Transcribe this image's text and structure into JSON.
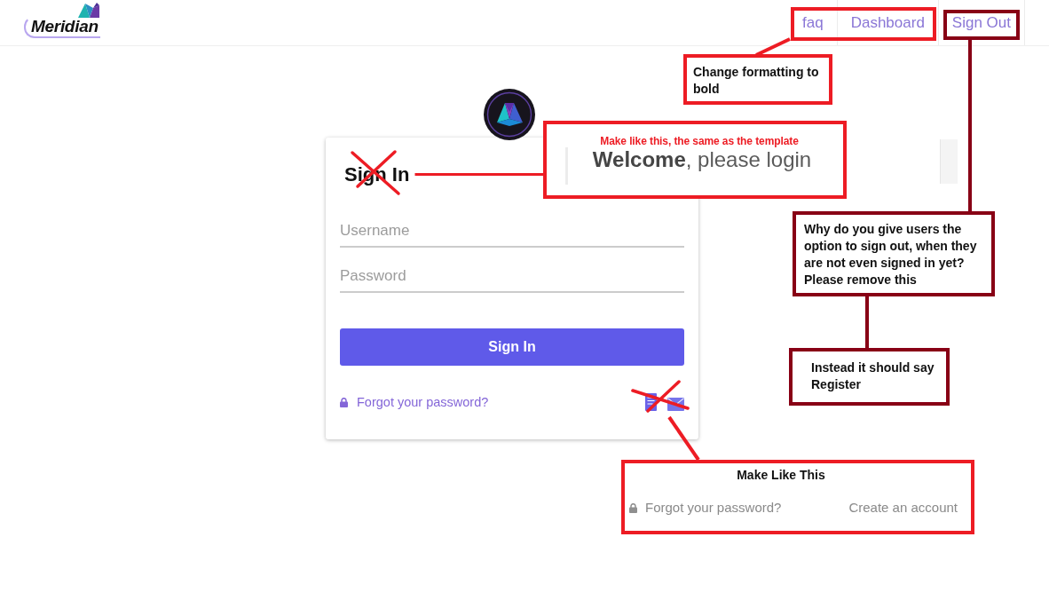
{
  "header": {
    "logo": "Meridian",
    "nav_groups": [
      {
        "color": "#ed1c24",
        "links": [
          {
            "label": "faq"
          },
          {
            "label": "Dashboard"
          }
        ]
      },
      {
        "color": "#880015",
        "links": [
          {
            "label": "Sign Out"
          }
        ]
      }
    ]
  },
  "login_card": {
    "title": "Sign In",
    "title_crossed_out": true,
    "fields": [
      {
        "placeholder": "Username"
      },
      {
        "placeholder": "Password"
      }
    ],
    "submit": "Sign In",
    "forgot_link": "Forgot your password?",
    "icons_crossed_out": true
  },
  "annotations": [
    {
      "kind": "note",
      "color": "#ed1c24",
      "text": "Change formatting to bold"
    },
    {
      "kind": "note",
      "color": "#880015",
      "text": "Why do you give users the option to sign out, when they are not even signed in yet? Please remove this"
    },
    {
      "kind": "note",
      "color": "#880015",
      "text": "Instead it should say Register"
    },
    {
      "kind": "heading_example",
      "color": "#ed1c24",
      "caption": "Make like this, the same as the template",
      "heading": "**Welcome**, please login"
    },
    {
      "kind": "links_example",
      "color": "#ed1c24",
      "caption": "Make Like This",
      "links": [
        {
          "kind": "lock",
          "label": "Forgot your password?"
        },
        {
          "kind": "plain",
          "label": "Create an account"
        }
      ]
    }
  ]
}
